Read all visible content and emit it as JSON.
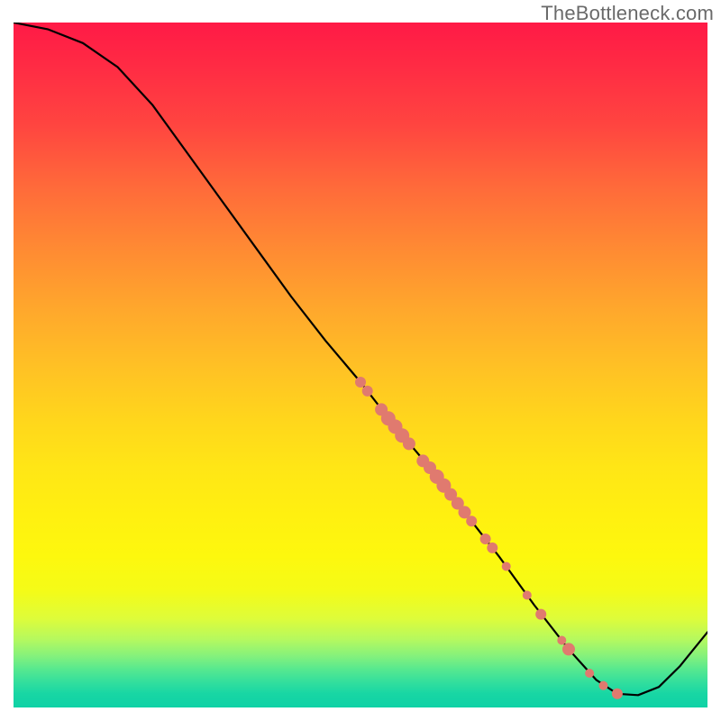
{
  "watermark": "TheBottleneck.com",
  "colors": {
    "gradient_top": "#ff1a46",
    "gradient_mid": "#fff010",
    "gradient_bottom": "#0fd2a6",
    "curve": "#000000",
    "marker": "#e07a6f"
  },
  "chart_data": {
    "type": "line",
    "title": "",
    "xlabel": "",
    "ylabel": "",
    "xlim": [
      0,
      100
    ],
    "ylim": [
      0,
      100
    ],
    "annotations": [
      "TheBottleneck.com"
    ],
    "curve": [
      {
        "x": 0,
        "y": 100
      },
      {
        "x": 5,
        "y": 99
      },
      {
        "x": 10,
        "y": 97
      },
      {
        "x": 15,
        "y": 93.5
      },
      {
        "x": 20,
        "y": 88
      },
      {
        "x": 25,
        "y": 81
      },
      {
        "x": 30,
        "y": 74
      },
      {
        "x": 35,
        "y": 67
      },
      {
        "x": 40,
        "y": 60
      },
      {
        "x": 45,
        "y": 53.5
      },
      {
        "x": 50,
        "y": 47.5
      },
      {
        "x": 55,
        "y": 41
      },
      {
        "x": 60,
        "y": 35
      },
      {
        "x": 65,
        "y": 28.5
      },
      {
        "x": 70,
        "y": 22
      },
      {
        "x": 75,
        "y": 15
      },
      {
        "x": 80,
        "y": 8.5
      },
      {
        "x": 84,
        "y": 4
      },
      {
        "x": 87,
        "y": 2
      },
      {
        "x": 90,
        "y": 1.8
      },
      {
        "x": 93,
        "y": 3
      },
      {
        "x": 96,
        "y": 6
      },
      {
        "x": 100,
        "y": 11
      }
    ],
    "series": [
      {
        "name": "markers",
        "points": [
          {
            "x": 50,
            "y": 47.5
          },
          {
            "x": 51,
            "y": 46.2
          },
          {
            "x": 53,
            "y": 43.5
          },
          {
            "x": 54,
            "y": 42.2
          },
          {
            "x": 55,
            "y": 41
          },
          {
            "x": 56,
            "y": 39.7
          },
          {
            "x": 57,
            "y": 38.5
          },
          {
            "x": 59,
            "y": 36
          },
          {
            "x": 60,
            "y": 35
          },
          {
            "x": 61,
            "y": 33.7
          },
          {
            "x": 62,
            "y": 32.4
          },
          {
            "x": 63,
            "y": 31.1
          },
          {
            "x": 64,
            "y": 29.8
          },
          {
            "x": 65,
            "y": 28.5
          },
          {
            "x": 66,
            "y": 27.2
          },
          {
            "x": 68,
            "y": 24.6
          },
          {
            "x": 69,
            "y": 23.3
          },
          {
            "x": 71,
            "y": 20.6
          },
          {
            "x": 74,
            "y": 16.4
          },
          {
            "x": 76,
            "y": 13.6
          },
          {
            "x": 79,
            "y": 9.8
          },
          {
            "x": 80,
            "y": 8.5
          },
          {
            "x": 83,
            "y": 5
          },
          {
            "x": 85,
            "y": 3.2
          },
          {
            "x": 87,
            "y": 2
          }
        ],
        "sizes": [
          6,
          6,
          7,
          8,
          8,
          8,
          7,
          7,
          7,
          8,
          8,
          7,
          7,
          7,
          6,
          6,
          6,
          5,
          5,
          6,
          5,
          7,
          5,
          5,
          6
        ]
      }
    ]
  }
}
